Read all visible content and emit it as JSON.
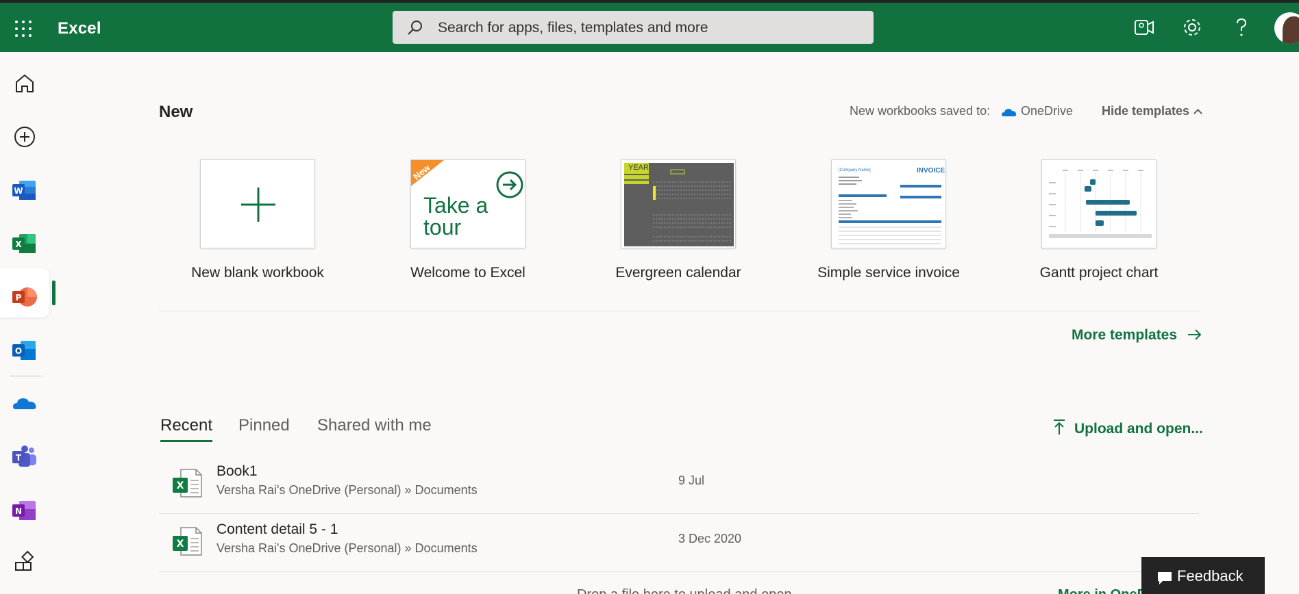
{
  "header": {
    "app_name": "Excel",
    "search_placeholder": "Search for apps, files, templates and more",
    "icons": [
      "waffle-icon",
      "search-icon",
      "meet-now-icon",
      "settings-icon",
      "help-icon",
      "avatar"
    ]
  },
  "rail": {
    "items": [
      "home-icon",
      "create-icon",
      "word-icon",
      "excel-icon",
      "powerpoint-icon",
      "outlook-icon",
      "onedrive-icon",
      "teams-icon",
      "onenote-icon",
      "apps-icon"
    ],
    "active": "excel-icon"
  },
  "new_section": {
    "title": "New",
    "saved_to_label": "New workbooks saved to:",
    "saved_to_location": "OneDrive",
    "hide_templates": "Hide templates",
    "more_templates": "More templates"
  },
  "templates": [
    {
      "label": "New blank workbook"
    },
    {
      "label": "Welcome to Excel",
      "badge": "New",
      "thumb_text": "Take a tour"
    },
    {
      "label": "Evergreen calendar",
      "thumb_text": "YEAR"
    },
    {
      "label": "Simple service invoice",
      "thumb_text": "INVOICE",
      "thumb_subtext": "[Company Name]"
    },
    {
      "label": "Gantt project chart"
    }
  ],
  "files_section": {
    "tabs": [
      "Recent",
      "Pinned",
      "Shared with me"
    ],
    "active_tab": "Recent",
    "upload_label": "Upload and open...",
    "files": [
      {
        "name": "Book1",
        "path": "Versha Rai's OneDrive (Personal) » Documents",
        "date": "9 Jul"
      },
      {
        "name": "Content detail 5 - 1",
        "path": "Versha Rai's OneDrive (Personal) » Documents",
        "date": "3 Dec 2020"
      }
    ],
    "cut_off_text": "Drop a file here to upload and open",
    "cut_off_link": "More in OneDrive"
  },
  "feedback_label": "Feedback",
  "colors": {
    "brand": "#117240",
    "background": "#faf9f8",
    "search": "#e1dfdd"
  }
}
